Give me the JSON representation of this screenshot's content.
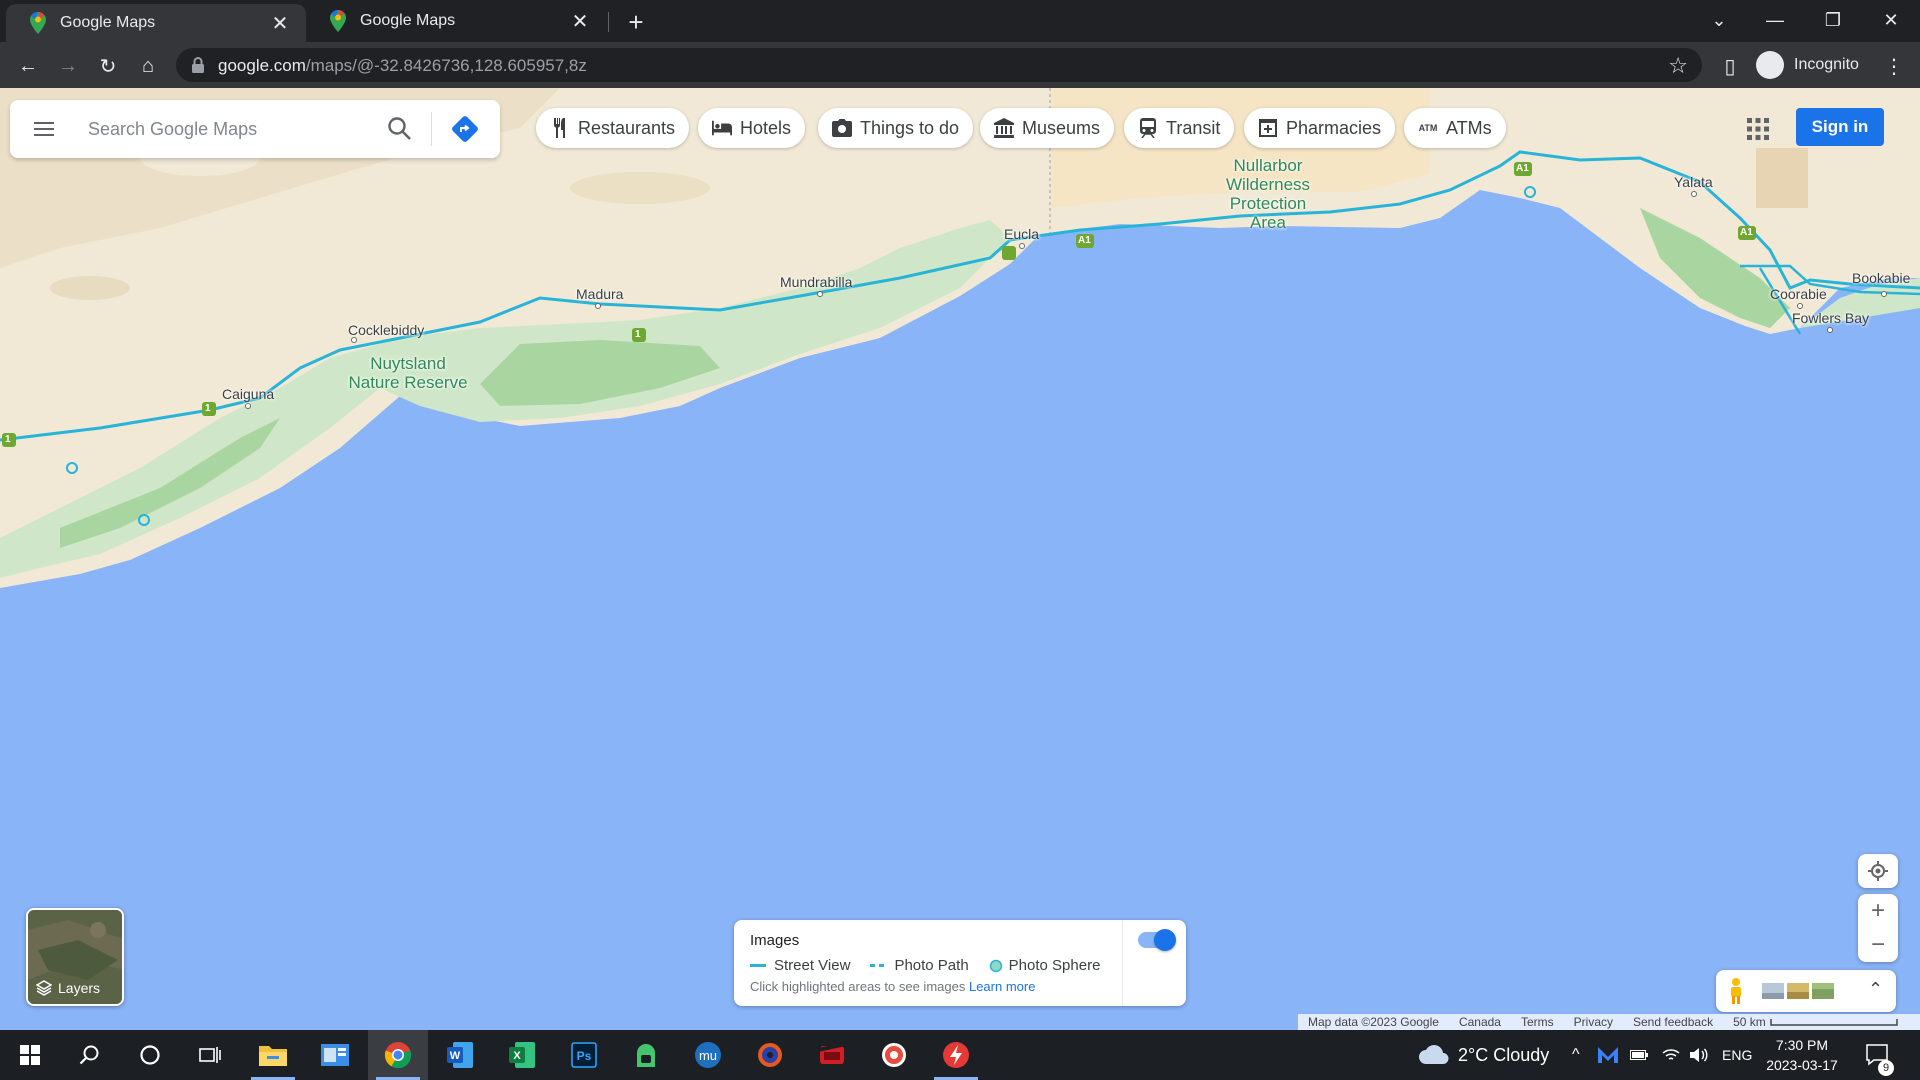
{
  "browser": {
    "tabs": [
      {
        "title": "Google Maps",
        "active": true
      },
      {
        "title": "Google Maps",
        "active": false
      }
    ],
    "url_host": "google.com",
    "url_path": "/maps/@-32.8426736,128.605957,8z",
    "profile_label": "Incognito"
  },
  "search": {
    "placeholder": "Search Google Maps"
  },
  "chips": [
    {
      "label": "Restaurants",
      "icon": "fork-knife-icon"
    },
    {
      "label": "Hotels",
      "icon": "bed-icon"
    },
    {
      "label": "Things to do",
      "icon": "camera-icon"
    },
    {
      "label": "Museums",
      "icon": "museum-icon"
    },
    {
      "label": "Transit",
      "icon": "train-icon"
    },
    {
      "label": "Pharmacies",
      "icon": "pharmacy-icon"
    },
    {
      "label": "ATMs",
      "icon": "atm-icon"
    }
  ],
  "signin_label": "Sign in",
  "map": {
    "places": [
      "Caiguna",
      "Cocklebiddy",
      "Madura",
      "Mundrabilla",
      "Eucla",
      "Yalata",
      "Coorabie",
      "Fowlers Bay",
      "Bookabie"
    ],
    "parks": [
      {
        "line1": "Nuytsland",
        "line2": "Nature Reserve"
      },
      {
        "line1": "Nullarbor",
        "line2": "Wilderness",
        "line3": "Protection",
        "line4": "Area"
      }
    ],
    "road_shields": [
      "1",
      "1",
      "1",
      "A1",
      "A1",
      "A1"
    ]
  },
  "layers_label": "Layers",
  "images_panel": {
    "title": "Images",
    "legend": [
      "Street View",
      "Photo Path",
      "Photo Sphere"
    ],
    "hint": "Click highlighted areas to see images",
    "link": "Learn more",
    "toggle_on": true
  },
  "footer": {
    "attribution": "Map data ©2023 Google",
    "region": "Canada",
    "terms": "Terms",
    "privacy": "Privacy",
    "feedback": "Send feedback",
    "scale": "50 km"
  },
  "taskbar": {
    "weather": "2°C  Cloudy",
    "lang": "ENG",
    "time": "7:30 PM",
    "date": "2023-03-17",
    "notifications": "9"
  },
  "colors": {
    "water": "#8ab4f8",
    "land": "#f1e9d6",
    "green": "#c8e6c9",
    "road": "#28b4d8",
    "accent": "#1a73e8"
  }
}
